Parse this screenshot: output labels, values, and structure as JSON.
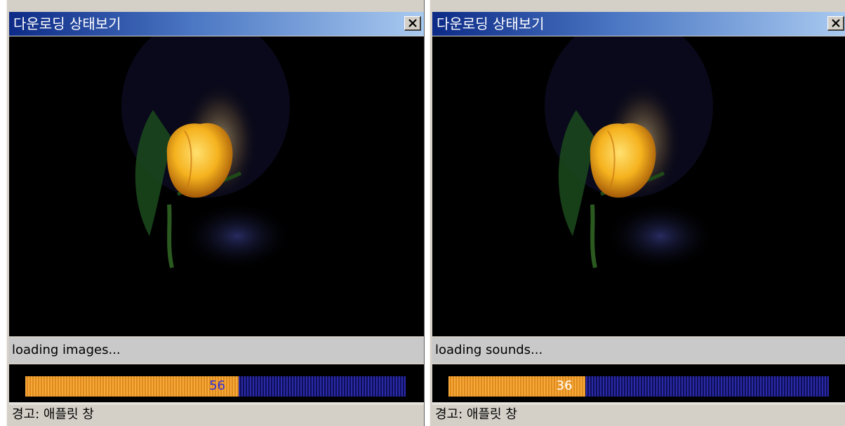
{
  "windows": [
    {
      "title": "다운로딩 상태보기",
      "status_text": "loading images...",
      "progress": {
        "value": 56,
        "label": "56"
      },
      "warning": "경고: 애플릿 창",
      "icons": {
        "close": "close-x-icon"
      }
    },
    {
      "title": "다운로딩 상태보기",
      "status_text": "loading sounds...",
      "progress": {
        "value": 36,
        "label": "36"
      },
      "warning": "경고: 애플릿 창",
      "icons": {
        "close": "close-x-icon"
      }
    }
  ],
  "colors": {
    "titlebar_start": "#0c2a86",
    "titlebar_end": "#a9caf0",
    "progress_fill": "#f6a83a",
    "progress_track": "#2a2aa6",
    "image_background": "#000000",
    "flower": "#f5b21e"
  }
}
